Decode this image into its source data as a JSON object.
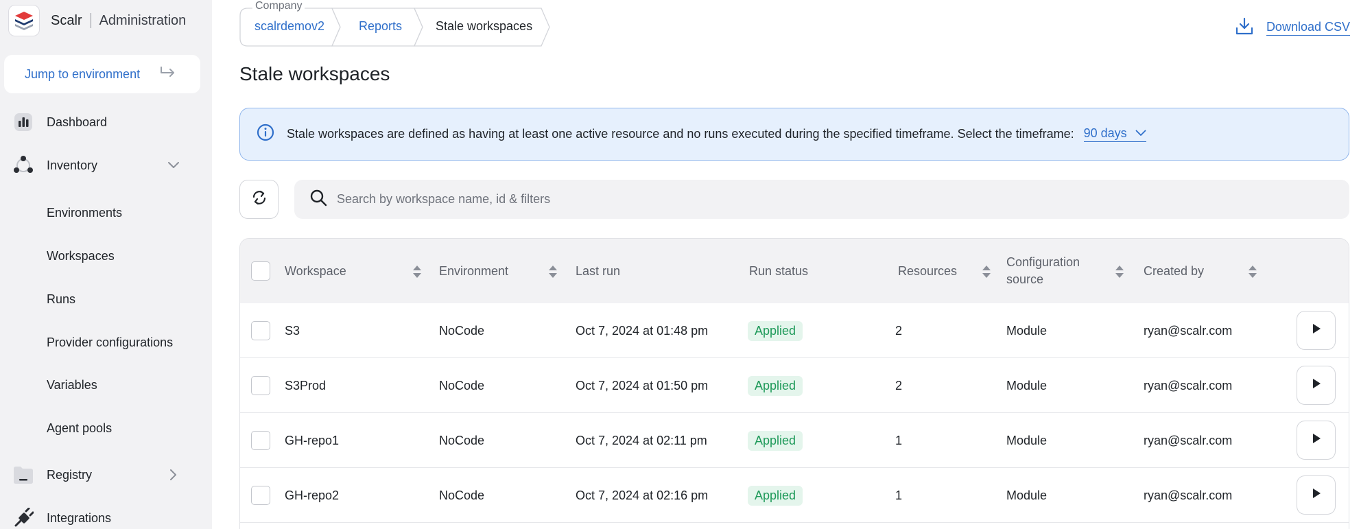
{
  "brand": {
    "name": "Scalr",
    "section": "Administration",
    "logo_icon": "scalr-logo-icon"
  },
  "jump": {
    "label": "Jump to environment",
    "icon": "enter-arrow-icon"
  },
  "nav": {
    "dashboard": {
      "label": "Dashboard",
      "icon": "dashboard-icon"
    },
    "inventory": {
      "label": "Inventory",
      "icon": "inventory-icon",
      "expanded": true,
      "children": [
        "Environments",
        "Workspaces",
        "Runs",
        "Provider configurations",
        "Variables",
        "Agent pools"
      ]
    },
    "registry": {
      "label": "Registry",
      "icon": "registry-icon"
    },
    "integrations": {
      "label": "Integrations",
      "icon": "plug-icon"
    }
  },
  "breadcrumb": {
    "company_label": "Company",
    "items": [
      "scalrdemov2",
      "Reports",
      "Stale workspaces"
    ]
  },
  "download": {
    "label": "Download CSV",
    "icon": "download-icon"
  },
  "page": {
    "title": "Stale workspaces"
  },
  "info": {
    "text": "Stale workspaces are defined as having at least one active resource and no runs executed during the specified timeframe. Select the timeframe:",
    "timeframe": "90 days"
  },
  "search": {
    "placeholder": "Search by workspace name, id & filters"
  },
  "table": {
    "columns": {
      "workspace": "Workspace",
      "environment": "Environment",
      "last_run": "Last run",
      "run_status": "Run status",
      "resources": "Resources",
      "config_source_1": "Configuration",
      "config_source_2": "source",
      "created_by": "Created by"
    },
    "rows": [
      {
        "workspace": "S3",
        "environment": "NoCode",
        "last_run": "Oct 7, 2024 at 01:48 pm",
        "status": "Applied",
        "resources": "2",
        "source": "Module",
        "created_by": "ryan@scalr.com"
      },
      {
        "workspace": "S3Prod",
        "environment": "NoCode",
        "last_run": "Oct 7, 2024 at 01:50 pm",
        "status": "Applied",
        "resources": "2",
        "source": "Module",
        "created_by": "ryan@scalr.com"
      },
      {
        "workspace": "GH-repo1",
        "environment": "NoCode",
        "last_run": "Oct 7, 2024 at 02:11 pm",
        "status": "Applied",
        "resources": "1",
        "source": "Module",
        "created_by": "ryan@scalr.com"
      },
      {
        "workspace": "GH-repo2",
        "environment": "NoCode",
        "last_run": "Oct 7, 2024 at 02:16 pm",
        "status": "Applied",
        "resources": "1",
        "source": "Module",
        "created_by": "ryan@scalr.com"
      }
    ]
  },
  "colors": {
    "accent": "#2f6fca",
    "success": "#1f9a5a",
    "success_bg": "#e4f5ec",
    "info_bg": "#e6f0fd"
  }
}
